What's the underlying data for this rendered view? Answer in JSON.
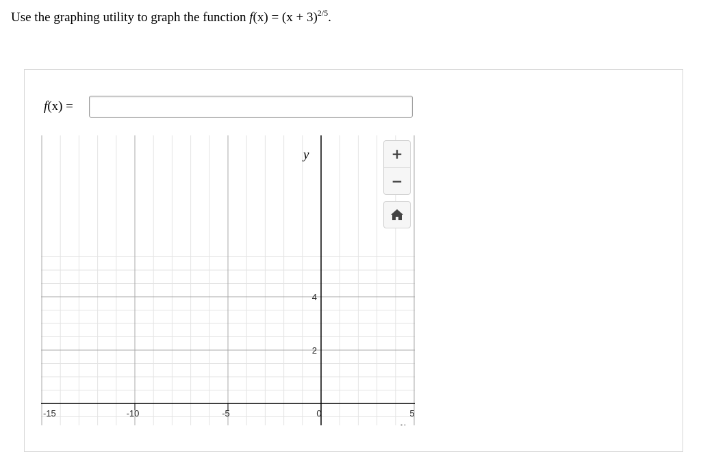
{
  "question": {
    "prefix": "Use the graphing utility to graph the function ",
    "func_name": "f",
    "func_arg": "(x)",
    "equals": " = ",
    "expression": "(x + 3)",
    "exponent": "2/5",
    "suffix": "."
  },
  "input": {
    "label_func": "f",
    "label_rest": "(x) =",
    "value": ""
  },
  "graph": {
    "x_axis_letter": "x",
    "y_axis_letter": "y",
    "x_range": [
      -15,
      5
    ],
    "y_range": [
      0,
      4
    ],
    "x_ticks": [
      "-15",
      "-10",
      "-5",
      "0",
      "5"
    ],
    "y_ticks": [
      "4",
      "2"
    ]
  },
  "controls": {
    "zoom_in": "+",
    "zoom_out": "−",
    "home_icon": "home-icon"
  }
}
